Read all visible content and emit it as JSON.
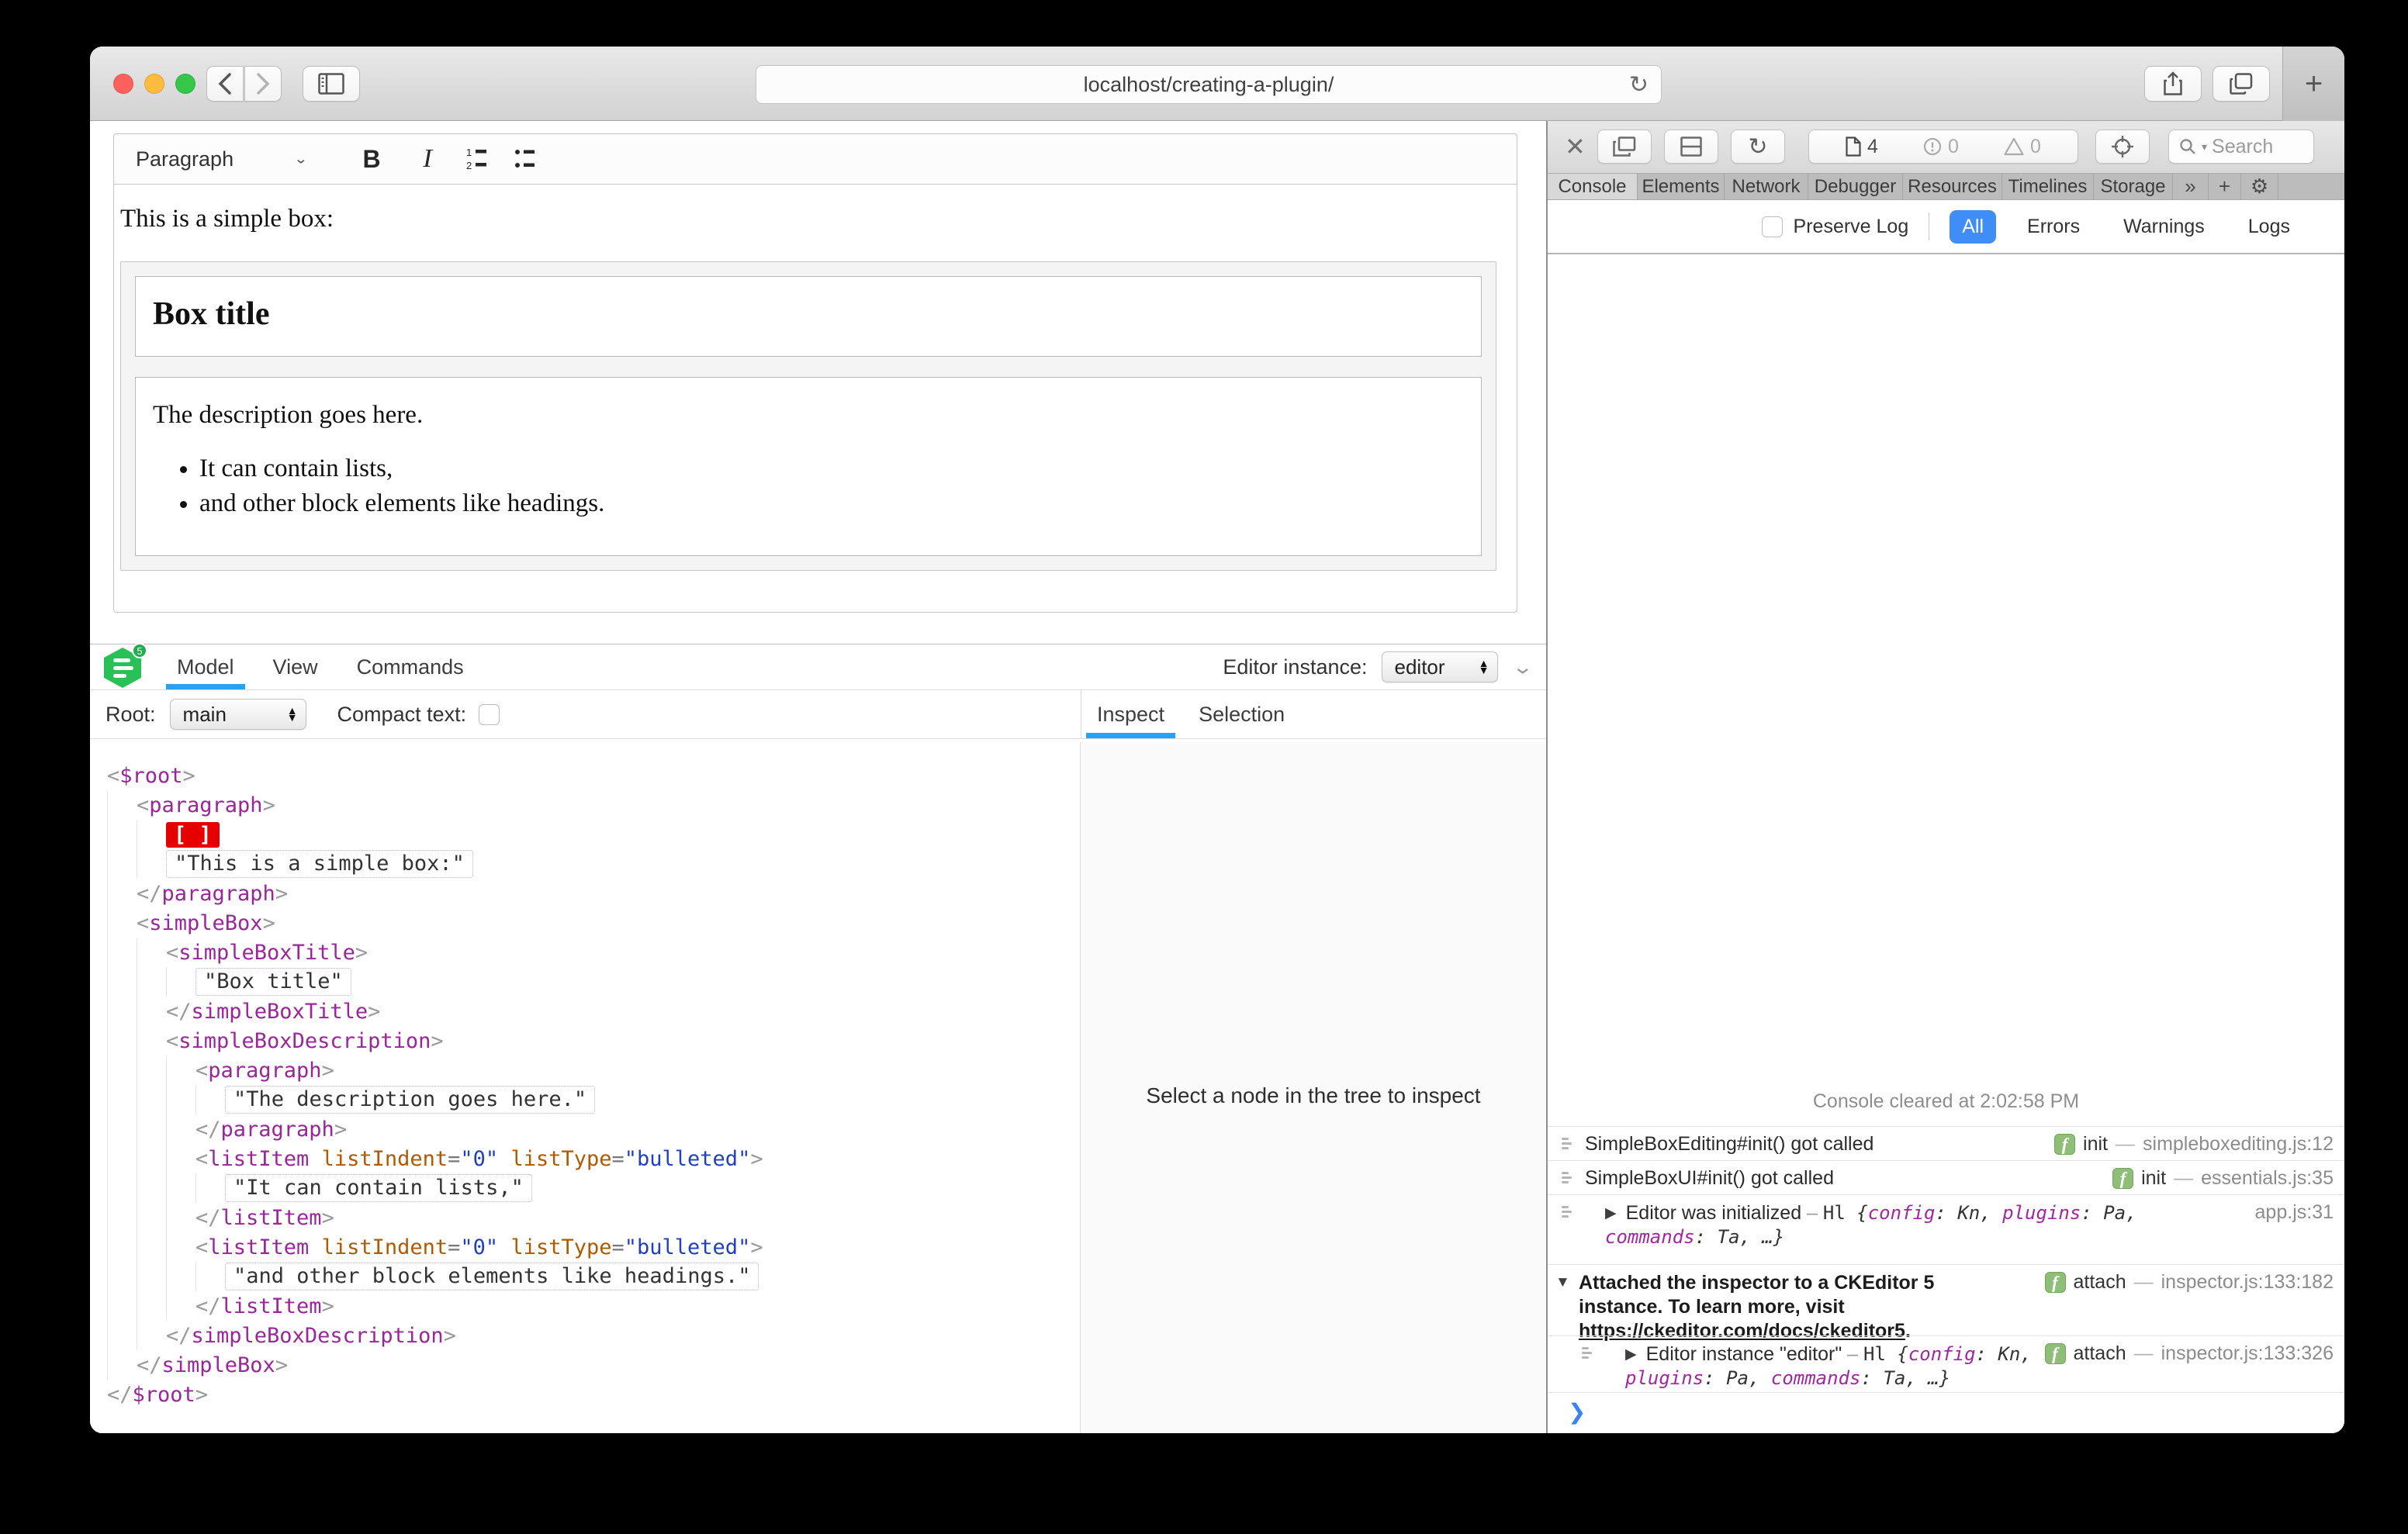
{
  "colors": {
    "accent_blue": "#3f8ef7",
    "inspector_tab_blue": "#2aa1f2",
    "badge_green": "#8fbe78",
    "logo_green": "#29c157",
    "selection_marker_red": "#e60000",
    "tag_purple": "#9b259b",
    "attr_orange": "#b25900",
    "attr_value_blue": "#2040c0",
    "traffic_red": "#fc615d",
    "traffic_yellow": "#fdbc40",
    "traffic_green": "#34c749"
  },
  "browser": {
    "url": "localhost/creating-a-plugin/",
    "reload_glyph": "↻",
    "new_tab_glyph": "+"
  },
  "editor": {
    "toolbar": {
      "heading_label": "Paragraph",
      "heading_chevron": "⌄",
      "bold_label": "B",
      "italic_label": "I"
    },
    "content": {
      "intro": "This is a simple box:",
      "box_title": "Box title",
      "description": "The description goes here.",
      "list_items": [
        "It can contain lists,",
        "and other block elements like headings."
      ]
    }
  },
  "inspector": {
    "logo_badge": "5",
    "tabs": [
      {
        "label": "Model",
        "active": true
      },
      {
        "label": "View",
        "active": false
      },
      {
        "label": "Commands",
        "active": false
      }
    ],
    "editor_instance_label": "Editor instance:",
    "editor_instance_value": "editor",
    "root_label": "Root:",
    "root_value": "main",
    "compact_text_label": "Compact text:",
    "side_tabs": [
      {
        "label": "Inspect",
        "active": true
      },
      {
        "label": "Selection",
        "active": false
      }
    ],
    "empty_message": "Select a node in the tree to inspect",
    "collapse_chevron": "⌄",
    "tree": [
      {
        "i": 0,
        "t": "open",
        "n": "$root"
      },
      {
        "i": 1,
        "t": "open",
        "n": "paragraph"
      },
      {
        "i": 2,
        "t": "marker",
        "text": "[ ]"
      },
      {
        "i": 2,
        "t": "text",
        "text": "\"This is a simple box:\""
      },
      {
        "i": 1,
        "t": "close",
        "n": "paragraph"
      },
      {
        "i": 1,
        "t": "open",
        "n": "simpleBox"
      },
      {
        "i": 2,
        "t": "open",
        "n": "simpleBoxTitle"
      },
      {
        "i": 3,
        "t": "text",
        "text": "\"Box title\""
      },
      {
        "i": 2,
        "t": "close",
        "n": "simpleBoxTitle"
      },
      {
        "i": 2,
        "t": "open",
        "n": "simpleBoxDescription"
      },
      {
        "i": 3,
        "t": "open",
        "n": "paragraph"
      },
      {
        "i": 4,
        "t": "text",
        "text": "\"The description goes here.\""
      },
      {
        "i": 3,
        "t": "close",
        "n": "paragraph"
      },
      {
        "i": 3,
        "t": "open",
        "n": "listItem",
        "attrs": [
          [
            "listIndent",
            "0"
          ],
          [
            "listType",
            "bulleted"
          ]
        ]
      },
      {
        "i": 4,
        "t": "text",
        "text": "\"It can contain lists,\""
      },
      {
        "i": 3,
        "t": "close",
        "n": "listItem"
      },
      {
        "i": 3,
        "t": "open",
        "n": "listItem",
        "attrs": [
          [
            "listIndent",
            "0"
          ],
          [
            "listType",
            "bulleted"
          ]
        ]
      },
      {
        "i": 4,
        "t": "text",
        "text": "\"and other block elements like headings.\""
      },
      {
        "i": 3,
        "t": "close",
        "n": "listItem"
      },
      {
        "i": 2,
        "t": "close",
        "n": "simpleBoxDescription"
      },
      {
        "i": 1,
        "t": "close",
        "n": "simpleBox"
      },
      {
        "i": 0,
        "t": "close",
        "n": "$root"
      }
    ]
  },
  "devtools": {
    "toolbar": {
      "close_glyph": "✕",
      "page_count": "4",
      "error_count": "0",
      "warning_count": "0",
      "search_placeholder": "Search"
    },
    "tabs": [
      {
        "label": "Console",
        "active": true
      },
      {
        "label": "Elements",
        "active": false
      },
      {
        "label": "Network",
        "active": false
      },
      {
        "label": "Debugger",
        "active": false
      },
      {
        "label": "Resources",
        "active": false
      },
      {
        "label": "Timelines",
        "active": false
      },
      {
        "label": "Storage",
        "active": false
      }
    ],
    "tabs_more_glyph": "»",
    "tabs_add_glyph": "+",
    "tabs_settings_glyph": "⚙",
    "filter": {
      "preserve_log_label": "Preserve Log",
      "scopes": [
        {
          "label": "All",
          "active": true
        },
        {
          "label": "Errors",
          "active": false
        },
        {
          "label": "Warnings",
          "active": false
        },
        {
          "label": "Logs",
          "active": false
        }
      ]
    },
    "console": {
      "cleared_message": "Console cleared at 2:02:58 PM",
      "prompt_glyph": "❯",
      "rows": [
        {
          "icon": true,
          "text": "SimpleBoxEditing#init() got called",
          "badge": "init",
          "location": "simpleboxediting.js:12"
        },
        {
          "icon": true,
          "text": "SimpleBoxUI#init() got called",
          "badge": "init",
          "location": "essentials.js:35"
        },
        {
          "icon": true,
          "caret": "▶",
          "text": "Editor was initialized",
          "sep": "–",
          "cls": "Hl",
          "obj": [
            [
              "config",
              "Kn"
            ],
            [
              "plugins",
              "Pa"
            ],
            [
              "commands",
              "Ta"
            ]
          ],
          "obj_tail": ", …}",
          "location": "app.js:31"
        },
        {
          "caret": "▼",
          "bold": true,
          "text": "Attached the inspector to a CKEditor 5 instance. To learn more, visit ",
          "link": "https://ckeditor.com/docs/ckeditor5",
          "after_link": ".",
          "badge": "attach",
          "location": "inspector.js:133:182"
        },
        {
          "icon": true,
          "caret": "▶",
          "nested": true,
          "text": "Editor instance \"editor\"",
          "sep": "–",
          "cls": "Hl",
          "obj": [
            [
              "config",
              "Kn"
            ],
            [
              "plugins",
              "Pa"
            ],
            [
              "commands",
              "Ta"
            ]
          ],
          "obj_tail": ", …}",
          "badge": "attach",
          "location": "inspector.js:133:326"
        }
      ]
    }
  }
}
